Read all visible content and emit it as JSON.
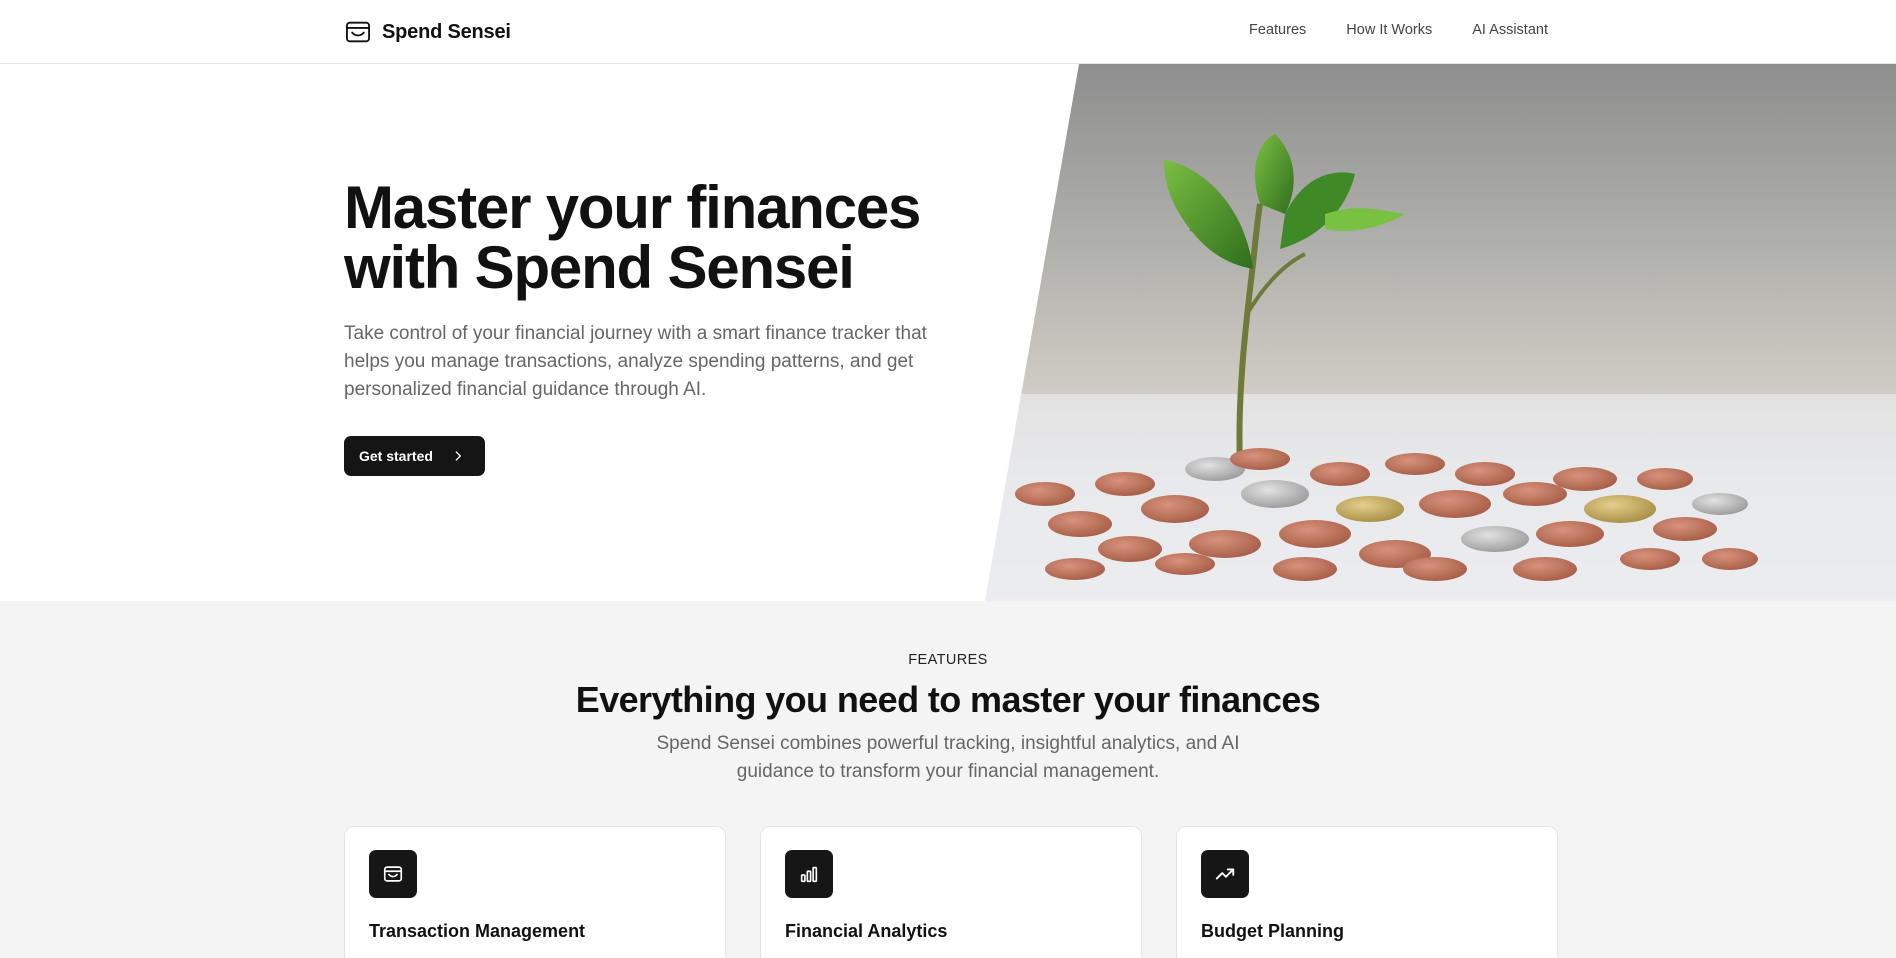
{
  "brand": {
    "name": "Spend Sensei",
    "icon": "wallet-icon"
  },
  "nav": [
    {
      "label": "Features"
    },
    {
      "label": "How It Works"
    },
    {
      "label": "AI Assistant"
    }
  ],
  "hero": {
    "title_line1": "Master your finances",
    "title_line2": "with Spend Sensei",
    "description": "Take control of your financial journey with a smart finance tracker that helps you manage transactions, analyze spending patterns, and get personalized financial guidance through AI.",
    "cta_label": "Get started",
    "cta_icon": "chevron-right-icon",
    "image": "plant-growing-from-coins"
  },
  "features": {
    "eyebrow": "FEATURES",
    "title": "Everything you need to master your finances",
    "description": "Spend Sensei combines powerful tracking, insightful analytics, and AI guidance to transform your financial management.",
    "cards": [
      {
        "icon": "wallet-icon",
        "title": "Transaction Management"
      },
      {
        "icon": "bar-chart-icon",
        "title": "Financial Analytics"
      },
      {
        "icon": "trending-up-icon",
        "title": "Budget Planning"
      }
    ]
  },
  "colors": {
    "primary": "#151515",
    "text": "#111111",
    "muted": "#666666",
    "section_bg": "#f4f4f4"
  }
}
